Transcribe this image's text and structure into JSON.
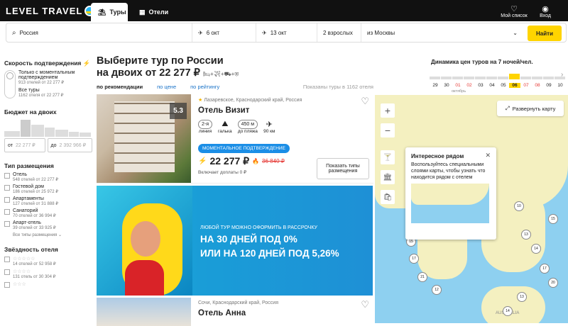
{
  "header": {
    "logo": "LEVEL TRAVEL",
    "tabs": [
      {
        "label": "Туры"
      },
      {
        "label": "Отели"
      }
    ],
    "my_list": "Мой список",
    "login": "Вход"
  },
  "search": {
    "destination": "Россия",
    "date_from": "6 окт",
    "date_to": "13 окт",
    "guests": "2 взрослых",
    "origin": "из Москвы",
    "button": "Найти"
  },
  "filters": {
    "speed_title": "Скорость подтверждения",
    "instant_label": "Только с моментальным подтверждением",
    "instant_count": "913 отелей от 22 277 ₽",
    "all_label": "Все туры",
    "all_count": "1162 отеля от 22 277 ₽",
    "budget_title": "Бюджет на двоих",
    "from_label": "от",
    "from_value": "22 277 ₽",
    "to_label": "до",
    "to_value": "2 392 966 ₽",
    "placement_title": "Тип размещения",
    "placements": [
      {
        "label": "Отель",
        "count": "548 отелей от 22 277 ₽"
      },
      {
        "label": "Гостевой дом",
        "count": "186 отелей от 25 972 ₽"
      },
      {
        "label": "Апартаменты",
        "count": "127 отелей от 31 888 ₽"
      },
      {
        "label": "Санаторий",
        "count": "70 отелей от 36 994 ₽"
      },
      {
        "label": "Апарт-отель",
        "count": "39 отелей от 33 925 ₽"
      }
    ],
    "more": "Все типы размещения",
    "stars_title": "Звёздность отеля",
    "stars": [
      {
        "count": "14 отелей от 52 958 ₽"
      },
      {
        "count": "131 отель от 30 304 ₽"
      },
      {
        "count": ""
      }
    ]
  },
  "main": {
    "title": "Выберите тур по России",
    "subtitle": "на двоих от 22 277 ₽",
    "sort": [
      "по рекомендации",
      "по цене",
      "по рейтингу"
    ],
    "count": "Показаны туры в 1162 отеля"
  },
  "hotel1": {
    "rating": "5.3",
    "location": "Лазаревское, Краснодарский край, Россия",
    "name": "Отель Визит",
    "line": "2-я",
    "line_label": "линия",
    "pebble": "галька",
    "beach": "450 м",
    "beach_label": "до пляжа",
    "flight": "90 км",
    "badge": "МОМЕНТАЛЬНОЕ ПОДТВЕРЖДЕНИЕ",
    "price": "22 277 ₽",
    "old_price": "36 840 ₽",
    "extra": "Включает доплаты 0 ₽",
    "button": "Показать типы размещения"
  },
  "banner": {
    "small": "ЛЮБОЙ ТУР МОЖНО ОФОРМИТЬ В РАССРОЧКУ",
    "line1": "НА 30 ДНЕЙ ПОД 0%",
    "line2": "ИЛИ НА 120 ДНЕЙ ПОД 5,26%"
  },
  "hotel2": {
    "location": "Сочи, Краснодарский край, Россия",
    "name": "Отель Анна"
  },
  "dynamics": {
    "title": "Динамика цен туров на 7 ночей/чел.",
    "dates": [
      "29",
      "30",
      "01",
      "02",
      "03",
      "04",
      "05",
      "06",
      "07",
      "08",
      "09",
      "10"
    ],
    "month": "октябрь"
  },
  "map": {
    "expand": "Развернуть карту",
    "popup_title": "Интересное рядом",
    "popup_text": "Воспользуйтесь специальными слоями карты, чтобы узнать что находится рядом с отелем",
    "label": "AUSTRALIA",
    "clusters": [
      "10",
      "13",
      "14",
      "15",
      "17",
      "20",
      "13",
      "14",
      "15",
      "17",
      "21",
      "12"
    ]
  },
  "colors": {
    "accent": "#ffd400",
    "link": "#1a73c8",
    "badge": "#1b8ee6"
  }
}
